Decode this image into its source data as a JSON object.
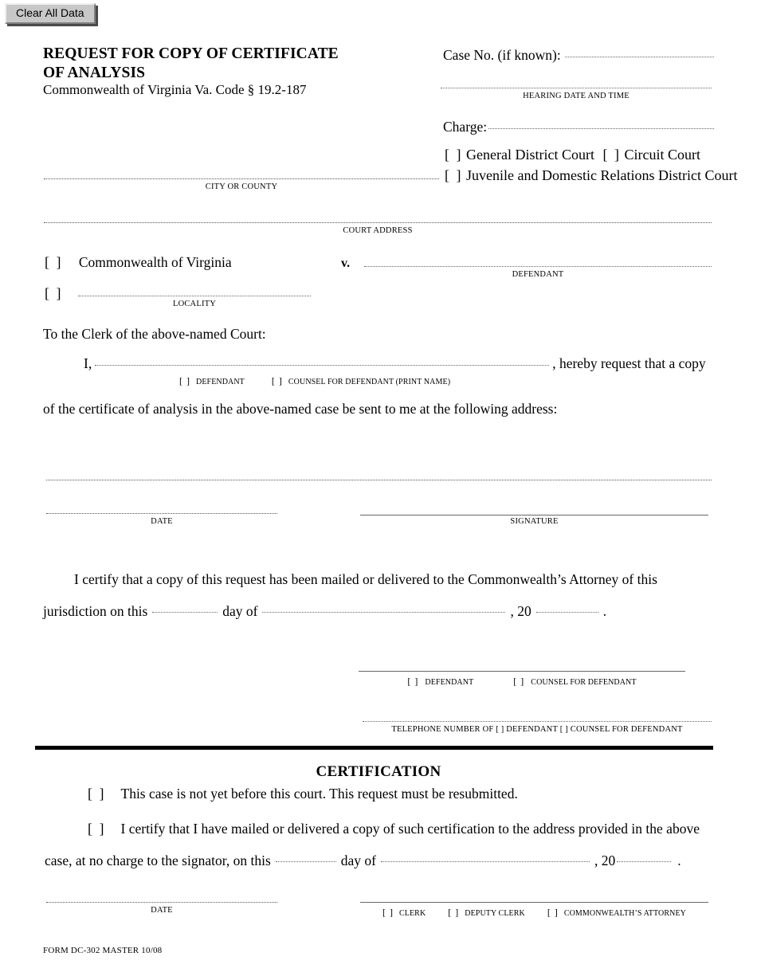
{
  "toolbar": {
    "clear_button_label": "Clear All Data"
  },
  "header": {
    "title_line1": "REQUEST FOR COPY OF CERTIFICATE",
    "title_line2": "OF ANALYSIS",
    "subtitle": "Commonwealth of Virginia   Va. Code § 19.2-187"
  },
  "case_block": {
    "case_no_label": "Case No. (if known):",
    "case_no_value": "",
    "hearing_caption": "HEARING DATE AND TIME",
    "hearing_value": "",
    "charge_label": "Charge:",
    "charge_value": "",
    "court_types": [
      {
        "bracket": "[   ]",
        "label": "General District Court"
      },
      {
        "bracket": "[   ]",
        "label": "Circuit Court"
      },
      {
        "bracket": "[   ]",
        "label": "Juvenile and Domestic Relations District Court"
      }
    ]
  },
  "court_info": {
    "city_or_county_caption": "CITY OR COUNTY",
    "city_or_county_value": "",
    "court_address_caption": "COURT ADDRESS",
    "court_address_value": ""
  },
  "parties": {
    "commonwealth_bracket": "[  ]",
    "commonwealth_label": "Commonwealth of Virginia",
    "versus": "v.",
    "defendant_caption": "DEFENDANT",
    "defendant_value": "",
    "locality_bracket": "[  ]",
    "locality_caption": "LOCALITY",
    "locality_value": ""
  },
  "body": {
    "to_clerk": "To the Clerk of the above-named Court:",
    "i_label": "I,",
    "name_value": "",
    "hereby_request": ", hereby request that a copy",
    "defendant_bracket": "[  ]",
    "defendant_option": "DEFENDANT",
    "counsel_bracket": "[  ]",
    "counsel_option": "COUNSEL FOR DEFENDANT (PRINT NAME)",
    "address_sentence": "of the certificate of analysis in the above-named case be sent to me at the following address:",
    "address_value": "",
    "date_caption": "DATE",
    "date_value": "",
    "signature_caption": "SIGNATURE",
    "signature_value": ""
  },
  "mailing_cert": {
    "paragraph": "I certify that a copy of this request has been mailed or delivered to the Commonwealth’s Attorney of this",
    "line_prefix": "jurisdiction on this",
    "day_value": "",
    "day_of": "day of",
    "month_value": "",
    "comma_20": ", 20",
    "year_value": "",
    "period": ".",
    "sig_defendant_bracket": "[  ]",
    "sig_defendant_label": "DEFENDANT",
    "sig_counsel_bracket": "[  ]",
    "sig_counsel_label": "COUNSEL FOR DEFENDANT",
    "telephone_value": "",
    "telephone_caption": "TELEPHONE NUMBER OF [  ] DEFENDANT [  ] COUNSEL FOR DEFENDANT"
  },
  "certification": {
    "heading": "CERTIFICATION",
    "option1_bracket": "[   ]",
    "option1_text": "This case is not yet before this court. This request must be resubmitted.",
    "option2_bracket": "[   ]",
    "option2_text": "I certify that I have mailed or delivered a copy of such certification to the address provided in the above",
    "line_prefix": "case, at no charge to the signator, on this",
    "day_value": "",
    "day_of": "day of",
    "month_value": "",
    "comma_20": ", 20",
    "year_value": "",
    "period": ".",
    "date_caption": "DATE",
    "date_value": "",
    "signature_value": "",
    "signers": [
      {
        "bracket": "[  ]",
        "label": "CLERK"
      },
      {
        "bracket": "[  ]",
        "label": "DEPUTY CLERK"
      },
      {
        "bracket": "[  ]",
        "label": "COMMONWEALTH’S ATTORNEY"
      }
    ]
  },
  "footer": {
    "form_number": "FORM DC-302 MASTER 10/08"
  }
}
